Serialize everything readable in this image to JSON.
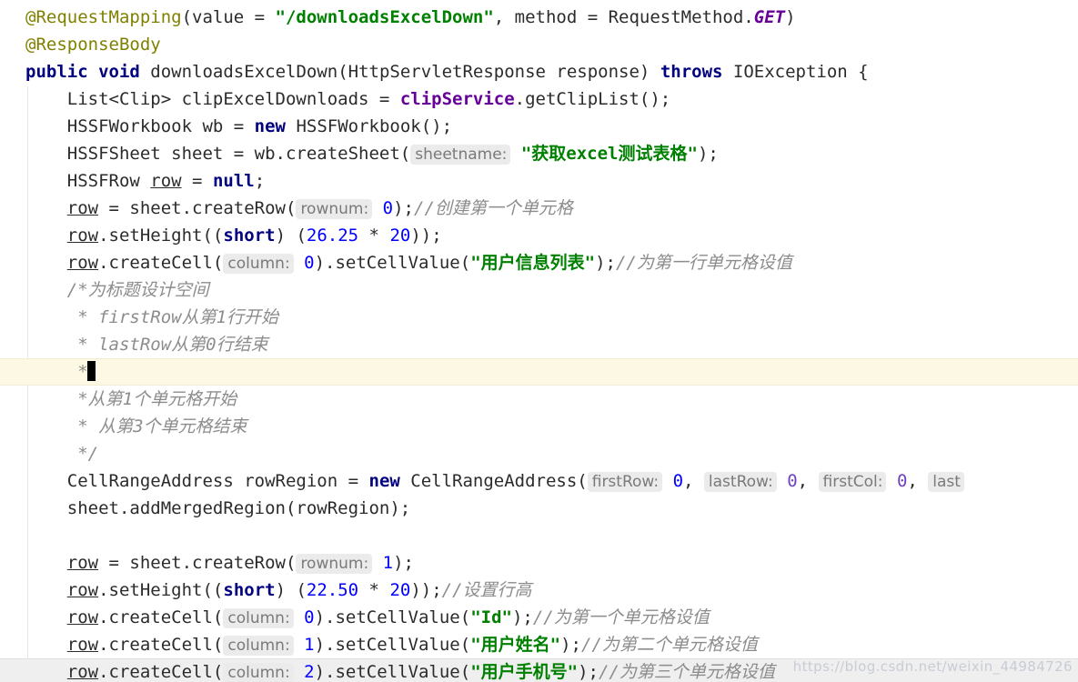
{
  "editor": {
    "language": "Java",
    "caret_line_index": 13,
    "colors": {
      "background": "#ffffff",
      "text": "#2b2b2b",
      "keyword": "#000080",
      "string": "#008000",
      "number": "#0000ff",
      "annotation": "#808000",
      "comment": "#8c8c8c",
      "field": "#660099",
      "static_field": "#660099",
      "hint_chip_bg": "#ebebeb",
      "hint_chip_text": "#7a7a7a",
      "current_line_bg": "#fdf8e3",
      "indent_guide": "#e6e6e6",
      "caret": "#000000",
      "watermark": "#c8ccd4"
    },
    "hints": {
      "sheetname": "sheetname:",
      "rownum": "rownum:",
      "column": "column:",
      "first_row": "firstRow:",
      "last_row": "lastRow:",
      "first_col": "firstCol:",
      "last_col_partial": "last"
    },
    "strings": {
      "mapping_value": "\"/downloadsExcelDown\"",
      "sheet_name": "\"获取excel测试表格\"",
      "header_title": "\"用户信息列表\"",
      "col_id": "\"Id\"",
      "col_name": "\"用户姓名\"",
      "col_phone": "\"用户手机号\""
    },
    "comments": {
      "create_first_cell": "//创建第一个单元格",
      "set_first_row_cell": "//为第一行单元格设值",
      "block_open": "/*为标题设计空间",
      "block_first_row": "* firstRow从第1行开始",
      "block_last_row": "* lastRow从第0行结束",
      "block_empty": "*",
      "block_first_cell": "*从第1个单元格开始",
      "block_last_cell": "* 从第3个单元格结束",
      "block_close": "*/",
      "set_row_height": "//设置行高",
      "set_cell_1": "//为第一个单元格设值",
      "set_cell_2": "//为第二个单元格设值",
      "set_cell_3": "//为第三个单元格设值"
    },
    "lines": [
      {
        "id": "l1",
        "text": "@RequestMapping(value = \"/downloadsExcelDown\", method = RequestMethod.GET)"
      },
      {
        "id": "l2",
        "text": "@ResponseBody"
      },
      {
        "id": "l3",
        "text": "public void downloadsExcelDown(HttpServletResponse response) throws IOException {"
      },
      {
        "id": "l4",
        "text": "    List<Clip> clipExcelDownloads = clipService.getClipList();"
      },
      {
        "id": "l5",
        "text": "    HSSFWorkbook wb = new HSSFWorkbook();"
      },
      {
        "id": "l6",
        "text": "    HSSFSheet sheet = wb.createSheet( sheetname: \"获取excel测试表格\");"
      },
      {
        "id": "l7",
        "text": "    HSSFRow row = null;"
      },
      {
        "id": "l8",
        "text": "    row = sheet.createRow( rownum: 0);//创建第一个单元格"
      },
      {
        "id": "l9",
        "text": "    row.setHeight((short) (26.25 * 20));"
      },
      {
        "id": "l10",
        "text": "    row.createCell( column: 0).setCellValue(\"用户信息列表\");//为第一行单元格设值"
      },
      {
        "id": "l11",
        "text": "    /*为标题设计空间"
      },
      {
        "id": "l12",
        "text": "     * firstRow从第1行开始"
      },
      {
        "id": "l13",
        "text": "     * lastRow从第0行结束"
      },
      {
        "id": "l14",
        "text": "     *"
      },
      {
        "id": "l15",
        "text": "     *从第1个单元格开始"
      },
      {
        "id": "l16",
        "text": "     * 从第3个单元格结束"
      },
      {
        "id": "l17",
        "text": "     */"
      },
      {
        "id": "l18",
        "text": "    CellRangeAddress rowRegion = new CellRangeAddress( firstRow: 0, lastRow: 0, firstCol: 0, last"
      },
      {
        "id": "l19",
        "text": "    sheet.addMergedRegion(rowRegion);"
      },
      {
        "id": "l20",
        "text": ""
      },
      {
        "id": "l21",
        "text": "    row = sheet.createRow( rownum: 1);"
      },
      {
        "id": "l22",
        "text": "    row.setHeight((short) (22.50 * 20));//设置行高"
      },
      {
        "id": "l23",
        "text": "    row.createCell( column: 0).setCellValue(\"Id\");//为第一个单元格设值"
      },
      {
        "id": "l24",
        "text": "    row.createCell( column: 1).setCellValue(\"用户姓名\");//为第二个单元格设值"
      },
      {
        "id": "l25",
        "text": "    row.createCell( column: 2).setCellValue(\"用户手机号\");//为第三个单元格设值"
      }
    ],
    "tokens": {
      "at_request_mapping": "@RequestMapping",
      "at_response_body": "@ResponseBody",
      "kw_public": "public",
      "kw_void": "void",
      "kw_new": "new",
      "kw_null": "null",
      "kw_throws": "throws",
      "kw_short": "short",
      "ident_method": "downloadsExcelDown",
      "ident_field_clipservice": "clipService",
      "ident_static_get": "GET",
      "ident_local_row": "row",
      "num_0": "0",
      "num_1": "1",
      "num_2": "2",
      "num_20": "20",
      "num_26_25": "26.25",
      "num_22_50": "22.50"
    }
  },
  "watermark": {
    "text": "https://blog.csdn.net/weixin_44984726"
  }
}
